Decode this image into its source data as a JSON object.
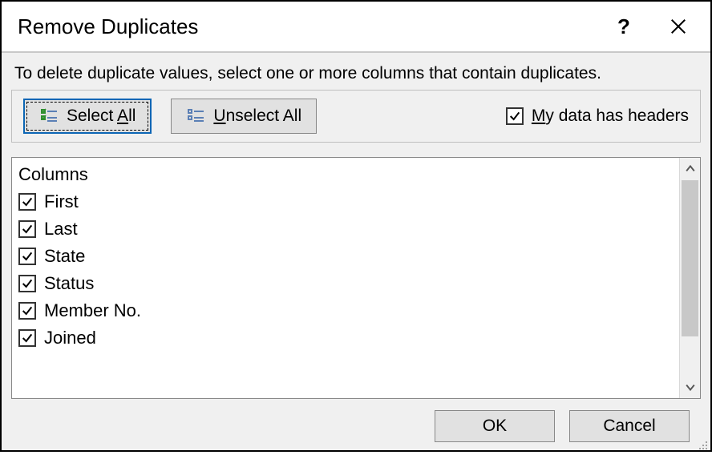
{
  "window": {
    "title": "Remove Duplicates"
  },
  "instruction": "To delete duplicate values, select one or more columns that contain duplicates.",
  "toolbar": {
    "select_all": {
      "pre": "Select ",
      "accel": "A",
      "post": "ll"
    },
    "unselect_all": {
      "accel": "U",
      "post": "nselect All"
    },
    "headers_checkbox": {
      "checked": true,
      "accel": "M",
      "post": "y data has headers"
    }
  },
  "columns_header": "Columns",
  "columns": [
    {
      "label": "First",
      "checked": true
    },
    {
      "label": "Last",
      "checked": true
    },
    {
      "label": "State",
      "checked": true
    },
    {
      "label": "Status",
      "checked": true
    },
    {
      "label": "Member No.",
      "checked": true
    },
    {
      "label": "Joined",
      "checked": true
    }
  ],
  "footer": {
    "ok": "OK",
    "cancel": "Cancel"
  }
}
